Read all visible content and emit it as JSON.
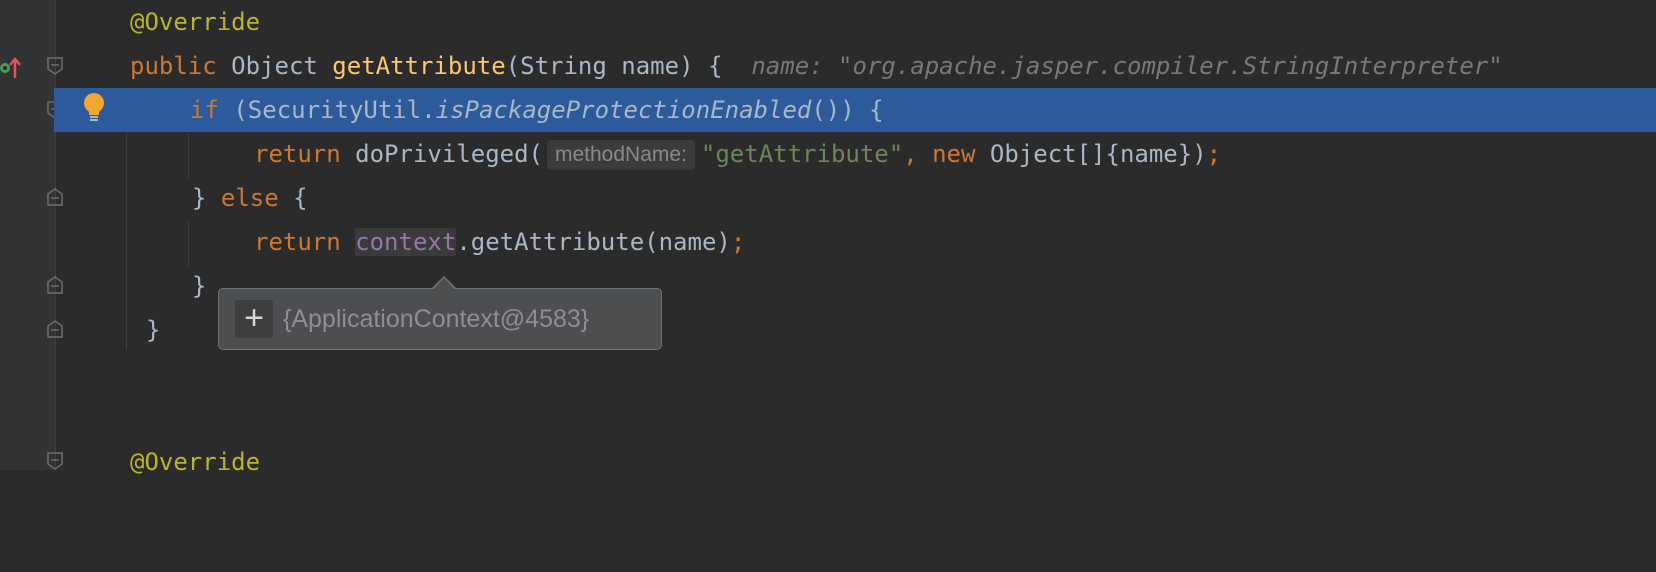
{
  "code": {
    "line1": {
      "annotation": "@Override"
    },
    "line2": {
      "kw_public": "public",
      "type": " Object ",
      "method": "getAttribute",
      "params": "(String name) {",
      "inline_value": "name: \"org.apache.jasper.compiler.StringInterpreter\""
    },
    "line3": {
      "kw_if": "if",
      "pre": " (SecurityUtil.",
      "method": "isPackageProtectionEnabled",
      "post": "()) {"
    },
    "line4": {
      "kw_return": "return",
      "call": " doPrivileged(",
      "hint": "methodName:",
      "str": "\"getAttribute\"",
      "comma": ",",
      "kw_new": " new",
      "rest": " Object[]{name})",
      "semi": ";"
    },
    "line5": {
      "brace": "} ",
      "kw_else": "else",
      "open": " {"
    },
    "line6": {
      "kw_return": "return",
      "space": " ",
      "field": "context",
      "rest": ".getAttribute(name)",
      "semi": ";"
    },
    "line7": {
      "brace": "}"
    },
    "line8": {
      "brace": "}"
    },
    "line11": {
      "annotation": "@Override"
    }
  },
  "tooltip": {
    "expand": "+",
    "value": "{ApplicationContext@4583}"
  },
  "colors": {
    "background": "#2b2b2b",
    "gutter": "#313335",
    "selection": "#2d5a9b",
    "keyword": "#cc7832",
    "annotation": "#bbb529",
    "method": "#ffc66d",
    "string": "#6a8759",
    "field": "#9876aa"
  },
  "icons": [
    "debug-breakpoint-icon",
    "lightbulb-icon",
    "fold-icon"
  ]
}
